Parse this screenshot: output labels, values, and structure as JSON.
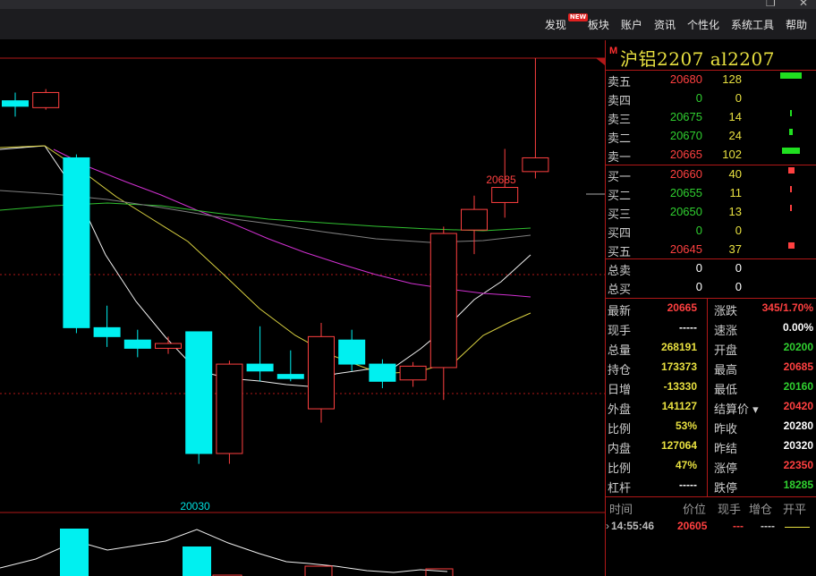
{
  "window": {
    "restore_glyph": "❐",
    "close_glyph": "✕"
  },
  "menu": {
    "items": [
      {
        "label": "发现",
        "badge": "NEW"
      },
      {
        "label": "板块"
      },
      {
        "label": "账户"
      },
      {
        "label": "资讯"
      },
      {
        "label": "个性化"
      },
      {
        "label": "系统工具"
      },
      {
        "label": "帮助"
      }
    ]
  },
  "colors": {
    "up": "#ff4040",
    "down": "#00f0f0",
    "accent": "#b01818",
    "text_yellow": "#e8e040"
  },
  "chart_data": {
    "type": "candlestick",
    "candles": [
      {
        "o": 20558,
        "h": 20570,
        "l": 20535,
        "c": 20550
      },
      {
        "o": 20548,
        "h": 20575,
        "l": 20545,
        "c": 20570
      },
      {
        "o": 20475,
        "h": 20480,
        "l": 20220,
        "c": 20228
      },
      {
        "o": 20228,
        "h": 20260,
        "l": 20200,
        "c": 20215
      },
      {
        "o": 20210,
        "h": 20225,
        "l": 20185,
        "c": 20198
      },
      {
        "o": 20198,
        "h": 20215,
        "l": 20190,
        "c": 20205
      },
      {
        "o": 20222,
        "h": 20222,
        "l": 20030,
        "c": 20045
      },
      {
        "o": 20045,
        "h": 20180,
        "l": 20030,
        "c": 20175
      },
      {
        "o": 20175,
        "h": 20230,
        "l": 20150,
        "c": 20165
      },
      {
        "o": 20160,
        "h": 20195,
        "l": 20150,
        "c": 20154
      },
      {
        "o": 20110,
        "h": 20235,
        "l": 20090,
        "c": 20215
      },
      {
        "o": 20210,
        "h": 20225,
        "l": 20165,
        "c": 20175
      },
      {
        "o": 20175,
        "h": 20182,
        "l": 20140,
        "c": 20150
      },
      {
        "o": 20152,
        "h": 20178,
        "l": 20142,
        "c": 20172
      },
      {
        "o": 20170,
        "h": 20375,
        "l": 20123,
        "c": 20365
      },
      {
        "o": 20370,
        "h": 20420,
        "l": 20335,
        "c": 20400
      },
      {
        "o": 20410,
        "h": 20488,
        "l": 20388,
        "c": 20432
      },
      {
        "o": 20455,
        "h": 20685,
        "l": 20445,
        "c": 20475
      }
    ],
    "high_label": "20685",
    "low_label": "20030",
    "ylim": [
      19980,
      20620
    ]
  },
  "quote": {
    "code_marker": "M",
    "title": "沪铝2207  al2207",
    "asks": [
      {
        "label": "卖五",
        "price": "20680",
        "vol": "128",
        "dir": "up",
        "bar": 24
      },
      {
        "label": "卖四",
        "price": "0",
        "vol": "0",
        "dir": "down",
        "bar": 0
      },
      {
        "label": "卖三",
        "price": "20675",
        "vol": "14",
        "dir": "down",
        "bar": 2
      },
      {
        "label": "卖二",
        "price": "20670",
        "vol": "24",
        "dir": "down",
        "bar": 4
      },
      {
        "label": "卖一",
        "price": "20665",
        "vol": "102",
        "dir": "up",
        "bar": 20
      }
    ],
    "bids": [
      {
        "label": "买一",
        "price": "20660",
        "vol": "40",
        "dir": "up",
        "bar": 7
      },
      {
        "label": "买二",
        "price": "20655",
        "vol": "11",
        "dir": "down",
        "bar": 2
      },
      {
        "label": "买三",
        "price": "20650",
        "vol": "13",
        "dir": "down",
        "bar": 2
      },
      {
        "label": "买四",
        "price": "0",
        "vol": "0",
        "dir": "down",
        "bar": 0
      },
      {
        "label": "买五",
        "price": "20645",
        "vol": "37",
        "dir": "up",
        "bar": 7
      }
    ],
    "totals": [
      {
        "label": "总卖",
        "a": "0",
        "b": "0"
      },
      {
        "label": "总买",
        "a": "0",
        "b": "0"
      }
    ],
    "stats": [
      {
        "l1": "最新",
        "v1": "20665",
        "c1": "red",
        "l2": "涨跌",
        "v2": "345/1.70%",
        "c2": "red"
      },
      {
        "l1": "现手",
        "v1": "-----",
        "c1": "white",
        "l2": "速涨",
        "v2": "0.00%",
        "c2": "white"
      },
      {
        "l1": "总量",
        "v1": "268191",
        "c1": "yellow",
        "l2": "开盘",
        "v2": "20200",
        "c2": "green"
      },
      {
        "l1": "持仓",
        "v1": "173373",
        "c1": "yellow",
        "l2": "最高",
        "v2": "20685",
        "c2": "red"
      },
      {
        "l1": "日增",
        "v1": "-13330",
        "c1": "yellow",
        "l2": "最低",
        "v2": "20160",
        "c2": "green"
      },
      {
        "l1": "外盘",
        "v1": "141127",
        "c1": "yellow",
        "l2": "结算价",
        "v2": "20420",
        "c2": "red"
      },
      {
        "l1": "比例",
        "v1": "53%",
        "c1": "yellow",
        "l2": "昨收",
        "v2": "20280",
        "c2": "white"
      },
      {
        "l1": "内盘",
        "v1": "127064",
        "c1": "yellow",
        "l2": "昨结",
        "v2": "20320",
        "c2": "white"
      },
      {
        "l1": "比例",
        "v1": "47%",
        "c1": "yellow",
        "l2": "涨停",
        "v2": "22350",
        "c2": "red"
      },
      {
        "l1": "杠杆",
        "v1": "-----",
        "c1": "white",
        "l2": "跌停",
        "v2": "18285",
        "c2": "green"
      }
    ],
    "settle_arrow": "▾",
    "tick_header": {
      "time": "时间",
      "price": "价位",
      "vol": "现手",
      "oi": "增仓",
      "type": "开平"
    },
    "tick": {
      "time": "14:55:46",
      "price": "20605",
      "vol": "---",
      "oi": "----"
    }
  }
}
